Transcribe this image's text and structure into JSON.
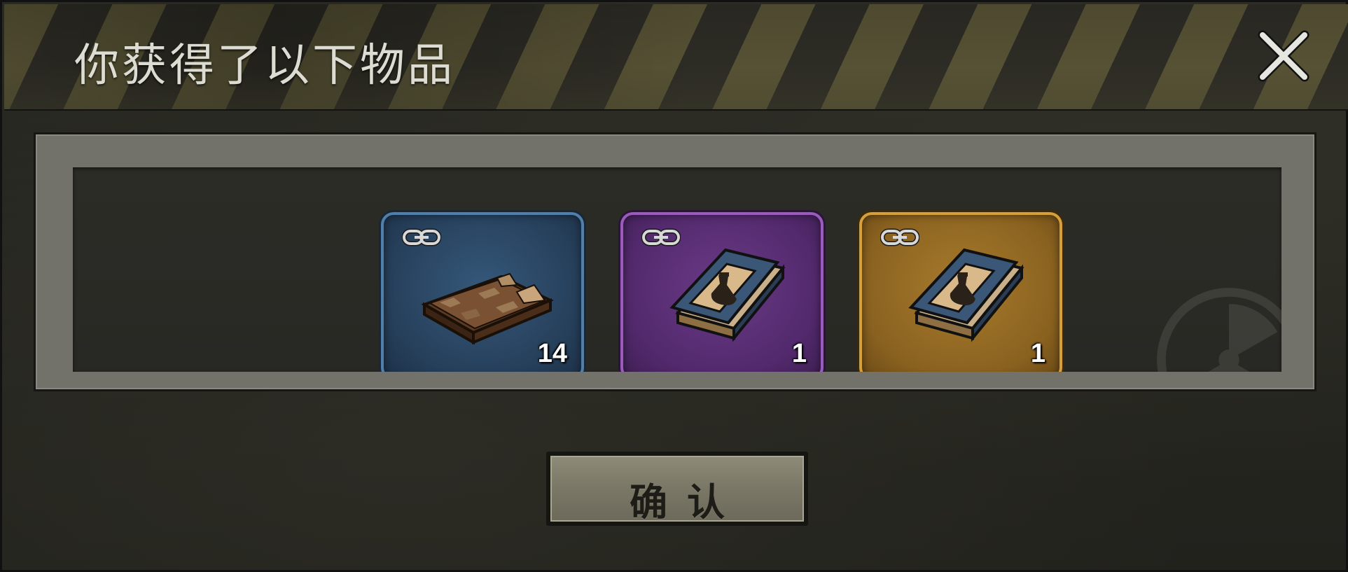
{
  "dialog": {
    "title": "你获得了以下物品",
    "close_icon": "close-icon"
  },
  "items": [
    {
      "rarity": "blue",
      "border_color": "#4f7fab",
      "icon": "torn-map-book-icon",
      "bound_icon": "chain-link-icon",
      "count": "14"
    },
    {
      "rarity": "purple",
      "border_color": "#9a5bbd",
      "icon": "flask-recipe-book-icon",
      "bound_icon": "chain-link-icon",
      "count": "1"
    },
    {
      "rarity": "orange",
      "border_color": "#d59f3c",
      "icon": "flask-recipe-book-icon",
      "bound_icon": "chain-link-icon",
      "count": "1"
    }
  ],
  "confirm": {
    "label": "确认"
  }
}
